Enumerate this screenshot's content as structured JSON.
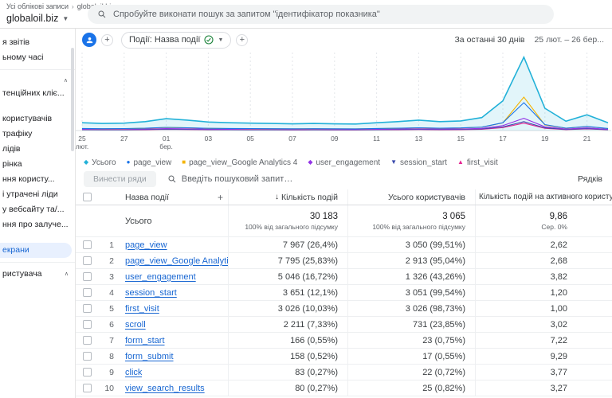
{
  "topbar": {
    "breadcrumb_root": "Усі облікові записи",
    "breadcrumb_current": "globaloil.biz",
    "search_placeholder": "Спробуйте виконати пошук за запитом \"ідентифікатор показника\""
  },
  "property": {
    "name": "globaloil.biz"
  },
  "sidebar": {
    "items": [
      {
        "label": "я звітів"
      },
      {
        "label": "ьному часі"
      },
      {
        "type": "divider"
      },
      {
        "type": "caret"
      },
      {
        "label": "тенційних кліє..."
      },
      {
        "type": "gap"
      },
      {
        "label": "користувачів"
      },
      {
        "label": "трафіку"
      },
      {
        "label": "лідів"
      },
      {
        "label": "рінка"
      },
      {
        "label": "ння користу..."
      },
      {
        "label": "і утрачені ліди"
      },
      {
        "label": "у вебсайту та/..."
      },
      {
        "label": "ння про залуче..."
      },
      {
        "type": "gap"
      },
      {
        "label": "екрани",
        "selected": true
      },
      {
        "type": "divider"
      },
      {
        "label": "ристувача",
        "caret": true
      }
    ]
  },
  "report": {
    "dimension_chip": "Події: Назва події",
    "date_range_label": "За останні 30 днів",
    "date_range_value": "25 лют. – 26 бер..."
  },
  "chart_data": {
    "type": "area",
    "domain_days": 25,
    "ylim": [
      0,
      4200
    ],
    "ticks": [
      {
        "day": 0,
        "label": "25",
        "sub": "лют."
      },
      {
        "day": 2,
        "label": "27"
      },
      {
        "day": 4,
        "label": "01",
        "sub": "бер."
      },
      {
        "day": 6,
        "label": "03"
      },
      {
        "day": 8,
        "label": "05"
      },
      {
        "day": 10,
        "label": "07"
      },
      {
        "day": 12,
        "label": "09"
      },
      {
        "day": 14,
        "label": "11"
      },
      {
        "day": 16,
        "label": "13"
      },
      {
        "day": 18,
        "label": "15"
      },
      {
        "day": 20,
        "label": "17"
      },
      {
        "day": 22,
        "label": "19"
      },
      {
        "day": 24,
        "label": "21"
      }
    ],
    "series": [
      {
        "name": "Усього",
        "color": "#22b1d8",
        "shape": "diamond",
        "fill": true,
        "values": [
          420,
          380,
          400,
          480,
          640,
          560,
          460,
          420,
          400,
          380,
          360,
          380,
          360,
          350,
          420,
          480,
          560,
          480,
          520,
          700,
          1600,
          3950,
          1200,
          500,
          850,
          420
        ]
      },
      {
        "name": "page_view",
        "color": "#1a73e8",
        "shape": "circle",
        "values": [
          110,
          100,
          105,
          125,
          170,
          150,
          120,
          110,
          105,
          100,
          95,
          100,
          95,
          90,
          110,
          125,
          150,
          125,
          140,
          185,
          420,
          1500,
          320,
          130,
          225,
          110
        ]
      },
      {
        "name": "page_view_Google Analytics 4",
        "color": "#f4b400",
        "shape": "square",
        "values": [
          105,
          95,
          100,
          120,
          165,
          145,
          115,
          105,
          100,
          95,
          90,
          95,
          90,
          88,
          105,
          120,
          145,
          120,
          135,
          180,
          410,
          1800,
          300,
          125,
          215,
          105
        ]
      },
      {
        "name": "user_engagement",
        "color": "#9334e6",
        "shape": "diamond",
        "values": [
          70,
          63,
          67,
          80,
          107,
          94,
          77,
          70,
          67,
          63,
          60,
          63,
          60,
          58,
          70,
          80,
          94,
          80,
          87,
          117,
          267,
          660,
          200,
          83,
          142,
          70
        ]
      },
      {
        "name": "session_start",
        "color": "#3949ab",
        "shape": "tdown",
        "values": [
          51,
          46,
          48,
          58,
          77,
          68,
          56,
          51,
          48,
          46,
          43,
          46,
          43,
          42,
          51,
          58,
          68,
          58,
          63,
          85,
          194,
          480,
          145,
          60,
          103,
          51
        ]
      },
      {
        "name": "first_visit",
        "color": "#e52592",
        "shape": "tup",
        "values": [
          42,
          38,
          40,
          48,
          64,
          56,
          46,
          42,
          40,
          38,
          36,
          38,
          36,
          35,
          42,
          48,
          56,
          48,
          52,
          70,
          160,
          400,
          120,
          50,
          85,
          42
        ]
      }
    ]
  },
  "table": {
    "export_rows_label": "Винести ряди",
    "search_placeholder": "Введіть пошуковий запит…",
    "rows_per_page_label": "Рядків",
    "columns": {
      "name": "Назва події",
      "metric1": "Кількість подій",
      "metric2": "Усього користувачів",
      "metric3": "Кількість подій на активного користувача"
    },
    "totals": {
      "label": "Усього",
      "metric1": "30 183",
      "metric1_sub": "100% від загального підсумку",
      "metric2": "3 065",
      "metric2_sub": "100% від загального підсумку",
      "metric3": "9,86",
      "metric3_sub": "Сер. 0%"
    },
    "rows": [
      {
        "index": "1",
        "name": "page_view",
        "metric1": "7 967 (26,4%)",
        "metric2": "3 050 (99,51%)",
        "metric3": "2,62"
      },
      {
        "index": "2",
        "name": "page_view_Google Analytics 4",
        "metric1": "7 795 (25,83%)",
        "metric2": "2 913 (95,04%)",
        "metric3": "2,68"
      },
      {
        "index": "3",
        "name": "user_engagement",
        "metric1": "5 046 (16,72%)",
        "metric2": "1 326 (43,26%)",
        "metric3": "3,82"
      },
      {
        "index": "4",
        "name": "session_start",
        "metric1": "3 651 (12,1%)",
        "metric2": "3 051 (99,54%)",
        "metric3": "1,20"
      },
      {
        "index": "5",
        "name": "first_visit",
        "metric1": "3 026 (10,03%)",
        "metric2": "3 026 (98,73%)",
        "metric3": "1,00"
      },
      {
        "index": "6",
        "name": "scroll",
        "metric1": "2 211 (7,33%)",
        "metric2": "731 (23,85%)",
        "metric3": "3,02"
      },
      {
        "index": "7",
        "name": "form_start",
        "metric1": "166 (0,55%)",
        "metric2": "23 (0,75%)",
        "metric3": "7,22"
      },
      {
        "index": "8",
        "name": "form_submit",
        "metric1": "158 (0,52%)",
        "metric2": "17 (0,55%)",
        "metric3": "9,29"
      },
      {
        "index": "9",
        "name": "click",
        "metric1": "83 (0,27%)",
        "metric2": "22 (0,72%)",
        "metric3": "3,77"
      },
      {
        "index": "10",
        "name": "view_search_results",
        "metric1": "80 (0,27%)",
        "metric2": "25 (0,82%)",
        "metric3": "3,27"
      }
    ]
  }
}
